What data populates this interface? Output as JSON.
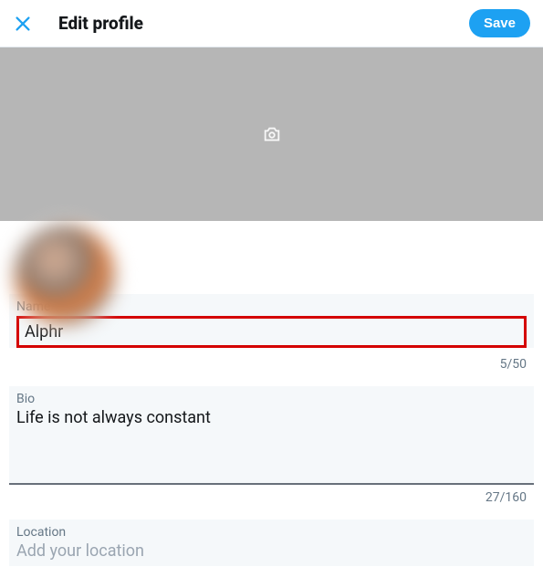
{
  "header": {
    "title": "Edit profile",
    "save_label": "Save"
  },
  "fields": {
    "name": {
      "label": "Name",
      "value": "Alphr",
      "counter": "5/50"
    },
    "bio": {
      "label": "Bio",
      "value": "Life is not always constant",
      "counter": "27/160"
    },
    "location": {
      "label": "Location",
      "placeholder": "Add your location",
      "value": ""
    }
  }
}
